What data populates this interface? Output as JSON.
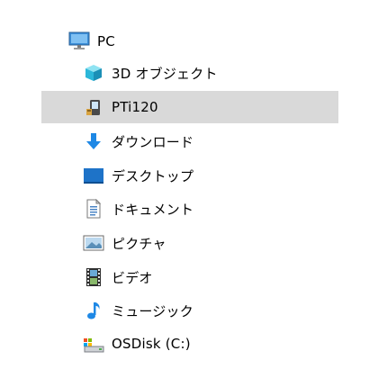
{
  "nav": {
    "root": {
      "label": "PC",
      "icon": "pc-icon"
    },
    "items": [
      {
        "label": "3D オブジェクト",
        "icon": "3d-objects-icon"
      },
      {
        "label": "PTi120",
        "icon": "portable-device-icon"
      },
      {
        "label": "ダウンロード",
        "icon": "download-arrow-icon"
      },
      {
        "label": "デスクトップ",
        "icon": "desktop-icon"
      },
      {
        "label": "ドキュメント",
        "icon": "document-icon"
      },
      {
        "label": "ピクチャ",
        "icon": "picture-icon"
      },
      {
        "label": "ビデオ",
        "icon": "video-film-icon"
      },
      {
        "label": "ミュージック",
        "icon": "music-note-icon"
      },
      {
        "label": "OSDisk (C:)",
        "icon": "os-disk-icon"
      }
    ],
    "selected_index": 1
  },
  "colors": {
    "selection": "#d9d9d9",
    "folder_blue": "#1e88e5",
    "text": "#000000"
  }
}
